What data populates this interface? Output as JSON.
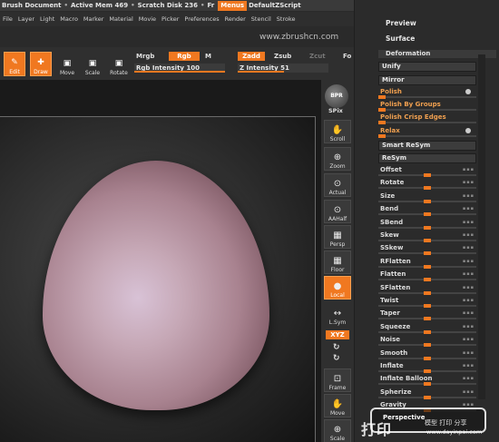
{
  "titlebar": {
    "items": [
      "Brush Document",
      "Active Mem 469",
      "Scratch Disk 236",
      "Fr"
    ],
    "menus_label": "Menus",
    "script_label": "DefaultZScript"
  },
  "menubar": {
    "items": [
      "File",
      "Layer",
      "Light",
      "Macro",
      "Marker",
      "Material",
      "Movie",
      "Picker",
      "Preferences",
      "Render",
      "Stencil",
      "Stroke"
    ]
  },
  "watermark": "www.zbrushcn.com",
  "shelf": {
    "edit": "Edit",
    "draw": "Draw",
    "move": "Move",
    "scale": "Scale",
    "rotate": "Rotate",
    "mrgb": "Mrgb",
    "rgb": "Rgb",
    "m": "M",
    "zadd": "Zadd",
    "zsub": "Zsub",
    "zcut": "Zcut",
    "focal": "Fo",
    "rgb_intensity_label": "Rgb Intensity",
    "rgb_intensity_value": "100",
    "z_intensity_label": "Z Intensity",
    "z_intensity_value": "51"
  },
  "right_tools": {
    "bpr": "BPR",
    "spix": "SPix",
    "scroll": "Scroll",
    "zoom": "Zoom",
    "actual": "Actual",
    "aahalf": "AAHalf",
    "persp": "Persp",
    "floor": "Floor",
    "local": "Local",
    "lsym": "L.Sym",
    "xyz": "XYZ",
    "frame": "Frame",
    "move": "Move",
    "scale": "Scale"
  },
  "palette": {
    "preview": "Preview",
    "surface": "Surface",
    "deformation": "Deformation",
    "unify": "Unify",
    "mirror": "Mirror",
    "polish": "Polish",
    "polish_groups": "Polish By Groups",
    "polish_crisp": "Polish Crisp Edges",
    "relax": "Relax",
    "smart_resym": "Smart ReSym",
    "resym": "ReSym",
    "sliders": [
      "Offset",
      "Rotate",
      "Size",
      "Bend",
      "SBend",
      "Skew",
      "SSkew",
      "RFlatten",
      "Flatten",
      "SFlatten",
      "Twist",
      "Taper",
      "Squeeze",
      "Noise",
      "Smooth",
      "Inflate",
      "Inflate Balloon",
      "Spherize",
      "Gravity",
      "Perspective"
    ],
    "row_marks": "▪▪▪"
  },
  "footer": {
    "label": "Perspective",
    "brand": "打印",
    "brand_sub": "模型 打印 分享",
    "brand_url": "www.dayinpai.com"
  },
  "colors": {
    "accent": "#f07820",
    "background": "#2a2a2a"
  }
}
